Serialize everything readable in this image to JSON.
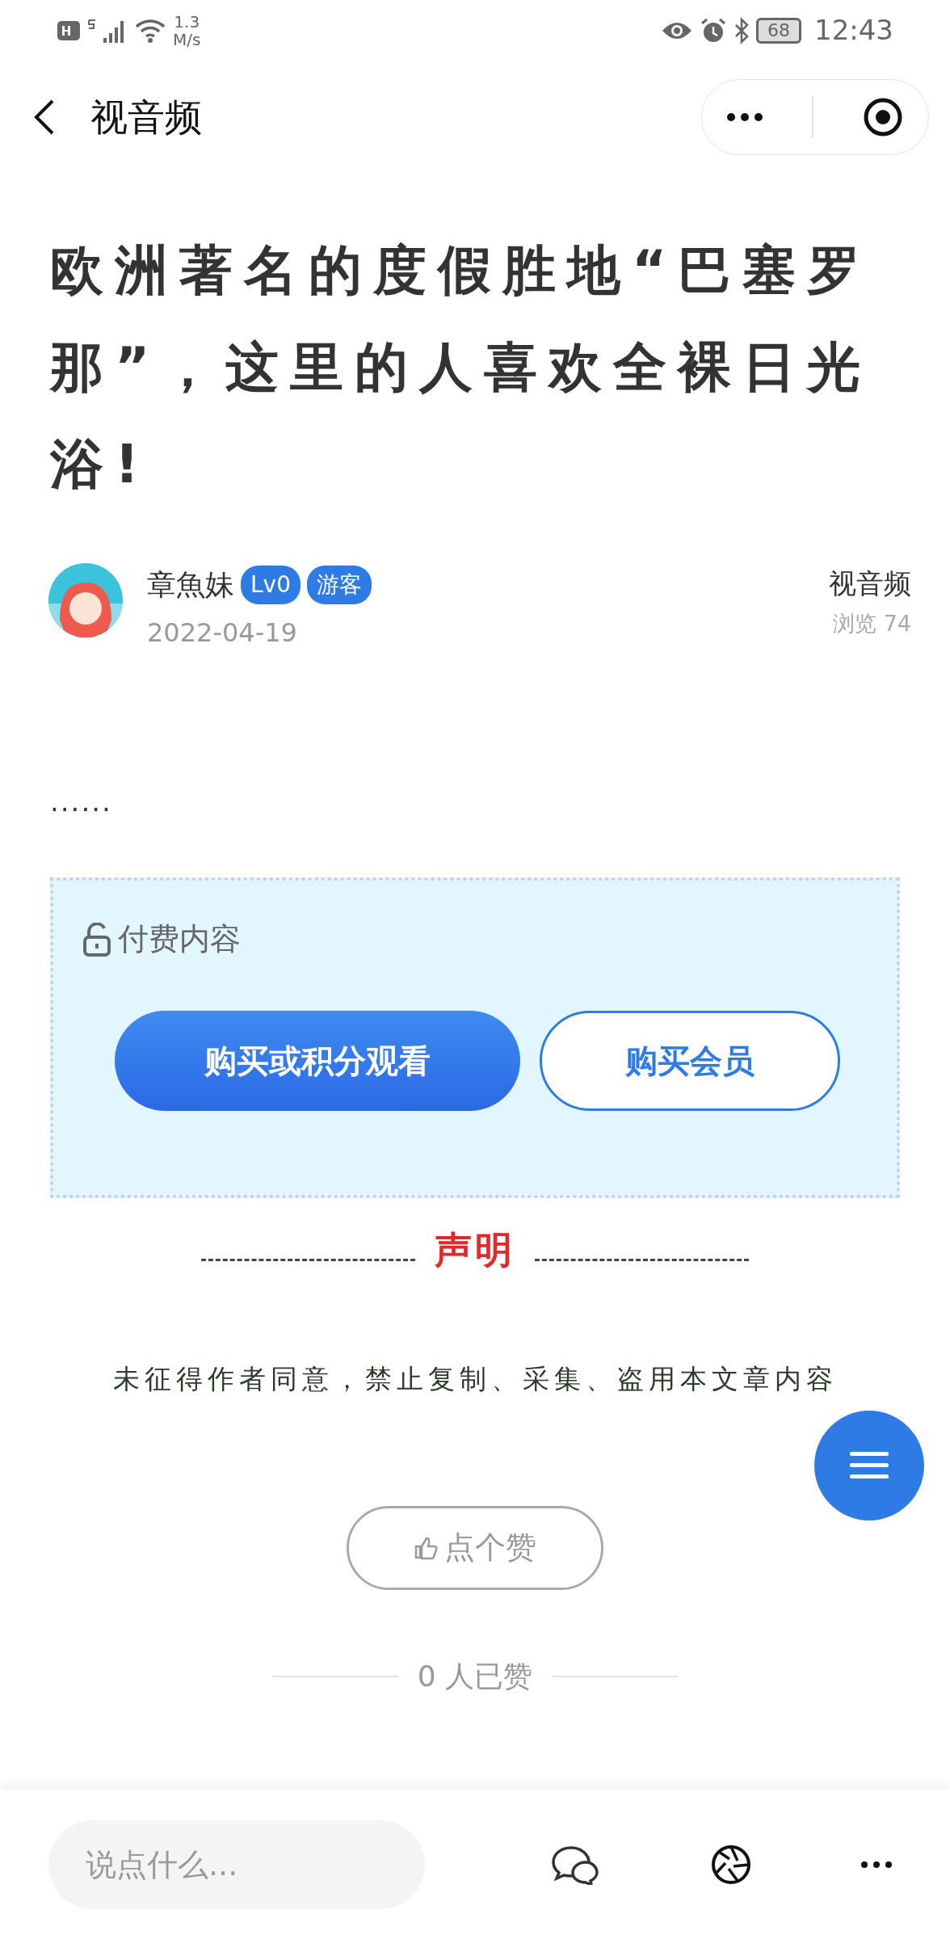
{
  "status_bar": {
    "speed_value": "1.3",
    "speed_unit": "M/s",
    "battery": "68",
    "time": "12:43"
  },
  "nav": {
    "title": "视音频"
  },
  "article": {
    "title": "欧洲著名的度假胜地“巴塞罗那”，这里的人喜欢全裸日光浴!",
    "author": {
      "name": "章魚妹",
      "badges": [
        "Lv0",
        "游客"
      ],
      "date": "2022-04-19",
      "category": "视音频",
      "views": "浏览 74"
    },
    "excerpt": "......",
    "paywall": {
      "label": "付费内容",
      "buttons": [
        {
          "label": "购买或积分观看",
          "kind": "primary"
        },
        {
          "label": "购买会员",
          "kind": "outline"
        }
      ]
    },
    "notice": {
      "heading": "声明",
      "text": "未征得作者同意，禁止复制、采集、盗用本文章内容"
    },
    "like": {
      "label": "点个赞",
      "count": "0 人已赞"
    }
  },
  "bottom_bar": {
    "comment_placeholder": "说点什么..."
  }
}
